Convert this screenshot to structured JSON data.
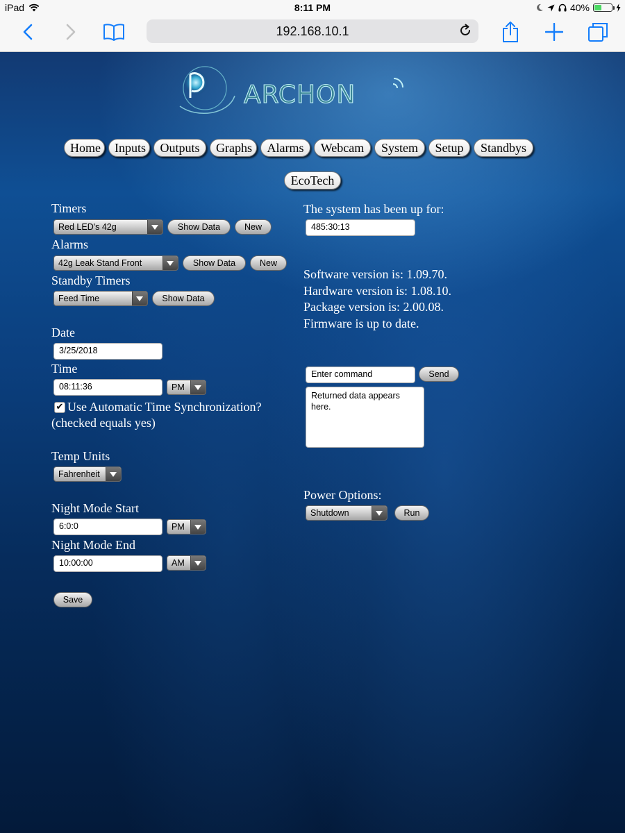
{
  "status_bar": {
    "device": "iPad",
    "time": "8:11 PM",
    "battery_percent": "40%",
    "battery_level": 0.4
  },
  "browser": {
    "url": "192.168.10.1"
  },
  "logo_text": "ARCHON",
  "nav": [
    {
      "label": "Home"
    },
    {
      "label": "Inputs"
    },
    {
      "label": "Outputs"
    },
    {
      "label": "Graphs"
    },
    {
      "label": "Alarms"
    },
    {
      "label": "Webcam"
    },
    {
      "label": "System"
    },
    {
      "label": "Setup"
    },
    {
      "label": "Standbys"
    },
    {
      "label": "EcoTech"
    }
  ],
  "left": {
    "timers": {
      "label": "Timers",
      "selected": "Red LED's 42g",
      "show_data": "Show Data",
      "new": "New"
    },
    "alarms": {
      "label": "Alarms",
      "selected": "42g Leak Stand Front",
      "show_data": "Show Data",
      "new": "New"
    },
    "standby_timers": {
      "label": "Standby Timers",
      "selected": "Feed Time",
      "show_data": "Show Data"
    },
    "date": {
      "label": "Date",
      "value": "3/25/2018"
    },
    "time": {
      "label": "Time",
      "value": "08:11:36",
      "ampm": "PM"
    },
    "auto_sync": {
      "label": "Use Automatic Time Synchronization?",
      "note": "(checked equals yes)",
      "checked": true
    },
    "temp_units": {
      "label": "Temp Units",
      "selected": "Fahrenheit"
    },
    "night_start": {
      "label": "Night Mode Start",
      "value": "6:0:0",
      "ampm": "PM"
    },
    "night_end": {
      "label": "Night Mode End",
      "value": "10:00:00",
      "ampm": "AM"
    },
    "save_label": "Save"
  },
  "right": {
    "uptime_label": "The system has been up for:",
    "uptime_value": "485:30:13",
    "versions": [
      "Software version is: 1.09.70.",
      "Hardware version is: 1.08.10.",
      "Package version is: 2.00.08.",
      "Firmware is up to date."
    ],
    "command": {
      "placeholder": "Enter command",
      "send": "Send",
      "returned": "Returned data appears here."
    },
    "power": {
      "label": "Power Options:",
      "selected": "Shutdown",
      "run": "Run"
    }
  },
  "colors": {
    "ios_blue": "#157efb",
    "page_text": "#ffffff",
    "logo_teal": "#6ec6d6"
  }
}
